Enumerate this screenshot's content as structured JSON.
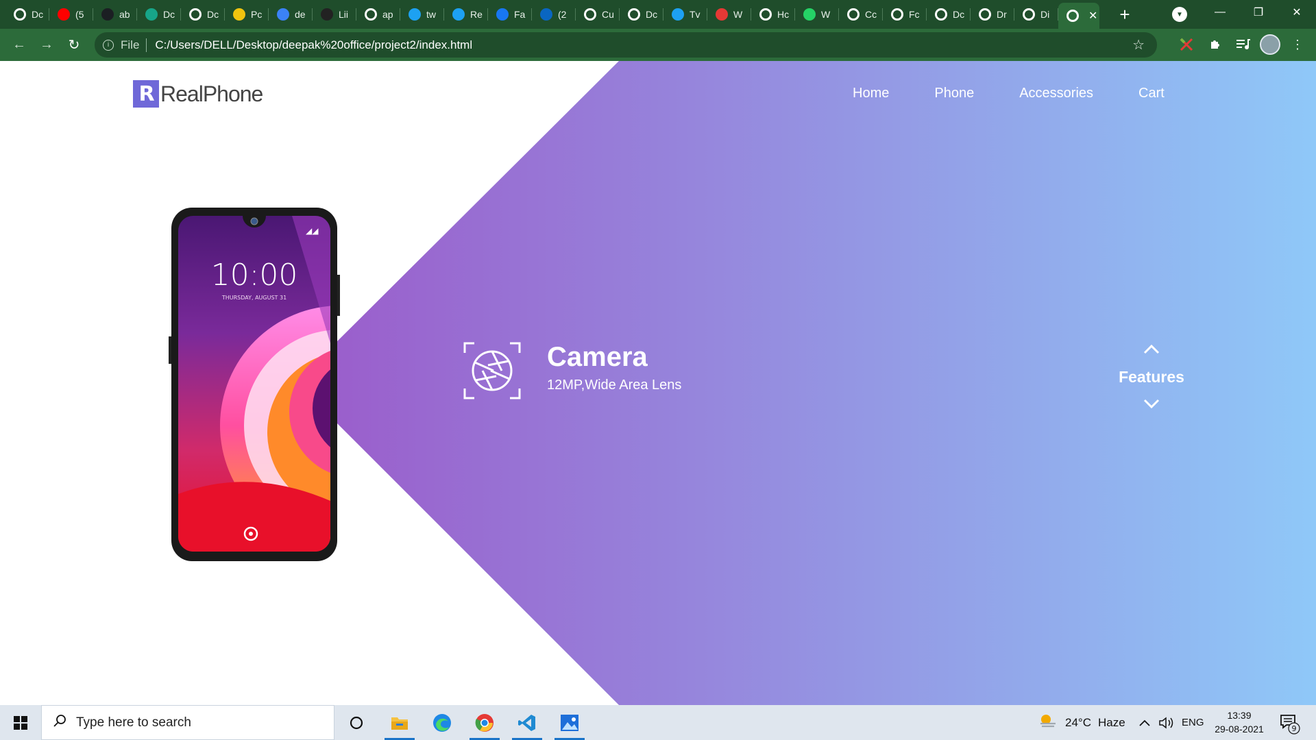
{
  "browser": {
    "tabs": [
      {
        "icon": "globe-icon",
        "label": "Dc",
        "color": "#ffffff"
      },
      {
        "icon": "youtube-icon",
        "label": "(5",
        "color": "#ff0000"
      },
      {
        "icon": "github-icon",
        "label": "ab",
        "color": "#1b1f23"
      },
      {
        "icon": "diamond-icon",
        "label": "Dc",
        "color": "#17a589"
      },
      {
        "icon": "globe-icon",
        "label": "Dc",
        "color": "#ffffff"
      },
      {
        "icon": "app-icon",
        "label": "Pc",
        "color": "#f1c40f"
      },
      {
        "icon": "c-icon",
        "label": "de",
        "color": "#3b82f6"
      },
      {
        "icon": "linkedin-learning-icon",
        "label": "Lii",
        "color": "#222222"
      },
      {
        "icon": "google-icon",
        "label": "ap",
        "color": "#ffffff"
      },
      {
        "icon": "twitter-icon",
        "label": "tw",
        "color": "#1da1f2"
      },
      {
        "icon": "twitter-icon",
        "label": "Re",
        "color": "#1da1f2"
      },
      {
        "icon": "facebook-icon",
        "label": "Fa",
        "color": "#1877f2"
      },
      {
        "icon": "linkedin-icon",
        "label": "(2",
        "color": "#0a66c2"
      },
      {
        "icon": "globe-icon",
        "label": "Cu",
        "color": "#ffffff"
      },
      {
        "icon": "globe-icon",
        "label": "Dc",
        "color": "#ffffff"
      },
      {
        "icon": "twitter-icon",
        "label": "Tv",
        "color": "#1da1f2"
      },
      {
        "icon": "alert-icon",
        "label": "W",
        "color": "#e53935"
      },
      {
        "icon": "globe-icon",
        "label": "Hc",
        "color": "#ffffff"
      },
      {
        "icon": "whatsapp-icon",
        "label": "W",
        "color": "#25d366"
      },
      {
        "icon": "globe-icon",
        "label": "Cc",
        "color": "#ffffff"
      },
      {
        "icon": "globe-icon",
        "label": "Fc",
        "color": "#ffffff"
      },
      {
        "icon": "globe-icon",
        "label": "Dc",
        "color": "#ffffff"
      },
      {
        "icon": "globe-icon",
        "label": "Dr",
        "color": "#ffffff"
      },
      {
        "icon": "globe-icon",
        "label": "Di",
        "color": "#ffffff"
      }
    ],
    "active_tab_icon": "globe-icon",
    "new_tab_label": "+",
    "address": {
      "scheme": "File",
      "url": "C:/Users/DELL/Desktop/deepak%20office/project2/index.html"
    },
    "theme_colors": {
      "tabstrip": "#1f4d2b",
      "toolbar": "#2c6b3a"
    }
  },
  "site": {
    "logo": {
      "mark": "R",
      "text": "RealPhone"
    },
    "nav": [
      "Home",
      "Phone",
      "Accessories",
      "Cart"
    ],
    "phone_screen": {
      "time": "10:00",
      "date": "THURSDAY, AUGUST 31"
    },
    "feature": {
      "icon": "camera-aperture-icon",
      "title": "Camera",
      "subtitle": "12MP,Wide Area Lens"
    },
    "features_control": {
      "label": "Features"
    },
    "colors": {
      "gradient_start": "#9a5fcc",
      "gradient_end": "#8fc8f8"
    }
  },
  "taskbar": {
    "search_placeholder": "Type here to search",
    "weather": {
      "temp": "24°C",
      "condition": "Haze"
    },
    "language": "ENG",
    "time": "13:39",
    "date": "29-08-2021",
    "notification_count": "9"
  }
}
